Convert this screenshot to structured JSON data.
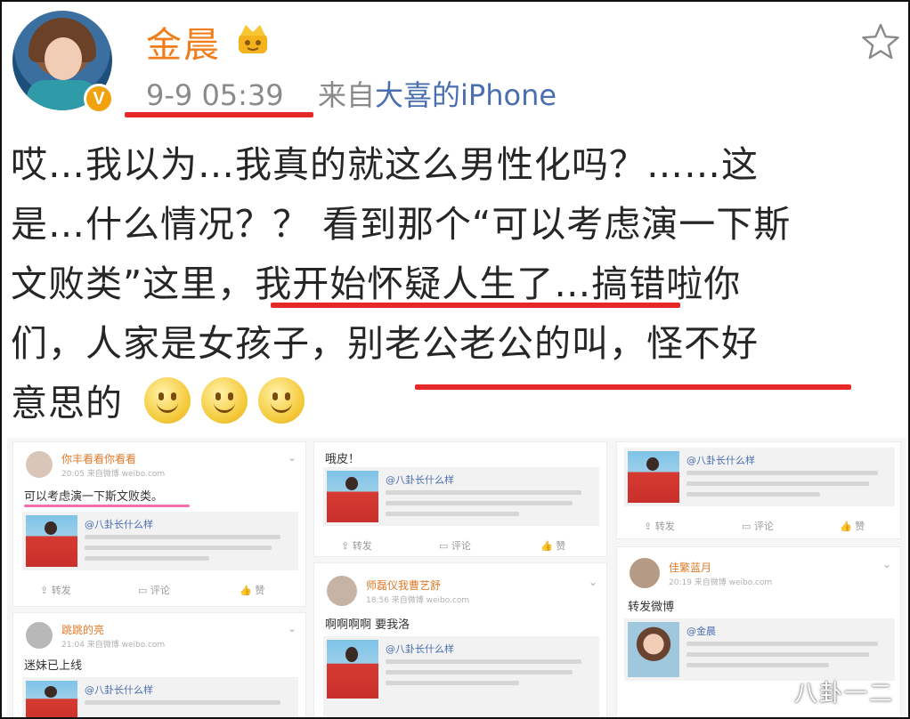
{
  "post": {
    "user": {
      "name": "金晨",
      "verified_badge": "V"
    },
    "time": "9-9 05:39",
    "source_prefix": "来自",
    "source_app": "大喜的iPhone",
    "text_lines": [
      "哎…我以为…我真的就这么男性化吗？……这",
      "是…什么情况？？ 看到那个“可以考虑演一下斯",
      "文败类”这里，我开始怀疑人生了…搞错啦你",
      "们，人家是女孩子，别老公老公的叫，怪不好",
      "意思的"
    ],
    "emojis": [
      "smile",
      "smile",
      "smile"
    ],
    "icons": {
      "favorite": "star-outline-icon",
      "crown": "crown-icon"
    },
    "highlight_color": "#e62828"
  },
  "collage": {
    "card1": {
      "name": "你丰看看你看看",
      "meta": "20:05 来自微博 weibo.com",
      "text": "可以考虑演一下斯文败类。",
      "repost_name": "@八卦长什么样",
      "actions": [
        "转发",
        "评论",
        "赞"
      ]
    },
    "card2": {
      "name": "跳跳的亮",
      "meta": "21:04 来自微博 weibo.com",
      "text": "迷妹已上线",
      "repost_name": "@八卦长什么样"
    },
    "card3": {
      "text": "哦皮！",
      "repost_name": "@八卦长什么样",
      "actions": [
        "转发",
        "评论",
        "赞"
      ]
    },
    "card4": {
      "name": "师磊仪我曹艺舒",
      "meta": "18:56 来自微博 weibo.com",
      "text": "啊啊啊啊 要我洛",
      "repost_name": "@八卦长什么样"
    },
    "card5": {
      "repost_name": "@八卦长什么样",
      "actions": [
        "转发",
        "评论",
        "赞"
      ]
    },
    "card6": {
      "name": "佳繁蓝月",
      "meta": "20:19 来自微博 weibo.com",
      "text": "转发微博",
      "repost_name": "@金晨"
    }
  },
  "watermark": "八卦一二"
}
